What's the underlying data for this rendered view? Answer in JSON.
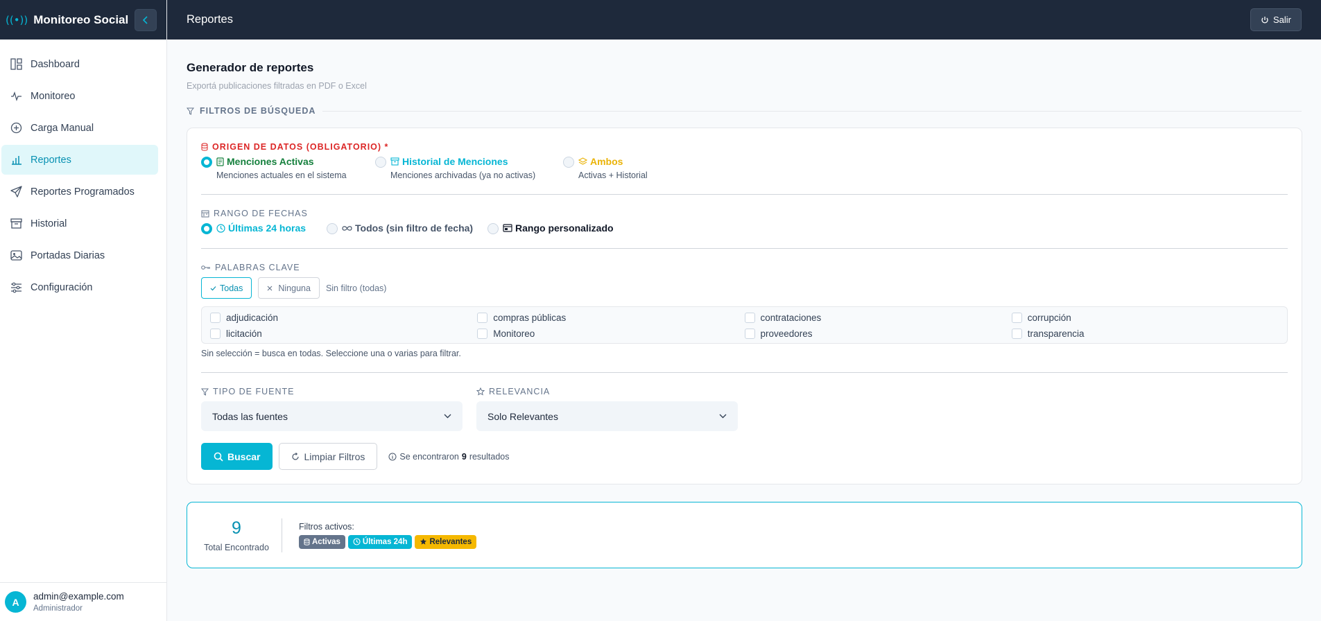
{
  "app": {
    "title": "Monitoreo Social",
    "brand_icon": "((•))"
  },
  "sidebar": {
    "items": [
      {
        "label": "Dashboard",
        "icon": "dashboard-icon"
      },
      {
        "label": "Monitoreo",
        "icon": "activity-icon"
      },
      {
        "label": "Carga Manual",
        "icon": "plus-circle-icon"
      },
      {
        "label": "Reportes",
        "icon": "bar-chart-icon",
        "active": true
      },
      {
        "label": "Reportes Programados",
        "icon": "send-icon"
      },
      {
        "label": "Historial",
        "icon": "archive-icon"
      },
      {
        "label": "Portadas Diarias",
        "icon": "image-icon"
      },
      {
        "label": "Configuración",
        "icon": "sliders-icon"
      }
    ],
    "user": {
      "initial": "A",
      "email": "admin@example.com",
      "role": "Administrador"
    }
  },
  "header": {
    "title": "Reportes",
    "logout_label": "Salir"
  },
  "page": {
    "title": "Generador de reportes",
    "subtitle": "Exportá publicaciones filtradas en PDF o Excel",
    "filters_heading": "FILTROS DE BÚSQUEDA"
  },
  "origin": {
    "label": "ORIGEN DE DATOS (OBLIGATORIO) *",
    "options": [
      {
        "title": "Menciones Activas",
        "desc": "Menciones actuales en el sistema",
        "color": "#15803d",
        "selected": true
      },
      {
        "title": "Historial de Menciones",
        "desc": "Menciones archivadas (ya no activas)",
        "color": "#06b6d4",
        "selected": false
      },
      {
        "title": "Ambos",
        "desc": "Activas + Historial",
        "color": "#eab308",
        "selected": false
      }
    ]
  },
  "dates": {
    "label": "RANGO DE FECHAS",
    "options": [
      {
        "title": "Últimas 24 horas",
        "selected": true
      },
      {
        "title": "Todos (sin filtro de fecha)",
        "selected": false
      },
      {
        "title": "Rango personalizado",
        "selected": false
      }
    ]
  },
  "keywords": {
    "label": "PALABRAS CLAVE",
    "all_label": "Todas",
    "none_label": "Ninguna",
    "status": "Sin filtro (todas)",
    "items": [
      "adjudicación",
      "compras públicas",
      "contrataciones",
      "corrupción",
      "licitación",
      "Monitoreo",
      "proveedores",
      "transparencia"
    ],
    "hint": "Sin selección = busca en todas. Seleccione una o varias para filtrar."
  },
  "source": {
    "label": "TIPO DE FUENTE",
    "value": "Todas las fuentes"
  },
  "relevance": {
    "label": "RELEVANCIA",
    "value": "Solo Relevantes"
  },
  "actions": {
    "search_label": "Buscar",
    "clear_label": "Limpiar Filtros",
    "results_prefix": "Se encontraron",
    "results_count": "9",
    "results_suffix": "resultados"
  },
  "summary": {
    "total": "9",
    "total_label": "Total Encontrado",
    "filters_label": "Filtros activos:",
    "badges": [
      {
        "label": "Activas",
        "color": "#64748b"
      },
      {
        "label": "Últimas 24h",
        "color": "#06b6d4"
      },
      {
        "label": "Relevantes",
        "color": "#f5b800"
      }
    ]
  },
  "colors": {
    "accent": "#06b6d4",
    "dark": "#1e293b",
    "danger": "#dc2626"
  }
}
